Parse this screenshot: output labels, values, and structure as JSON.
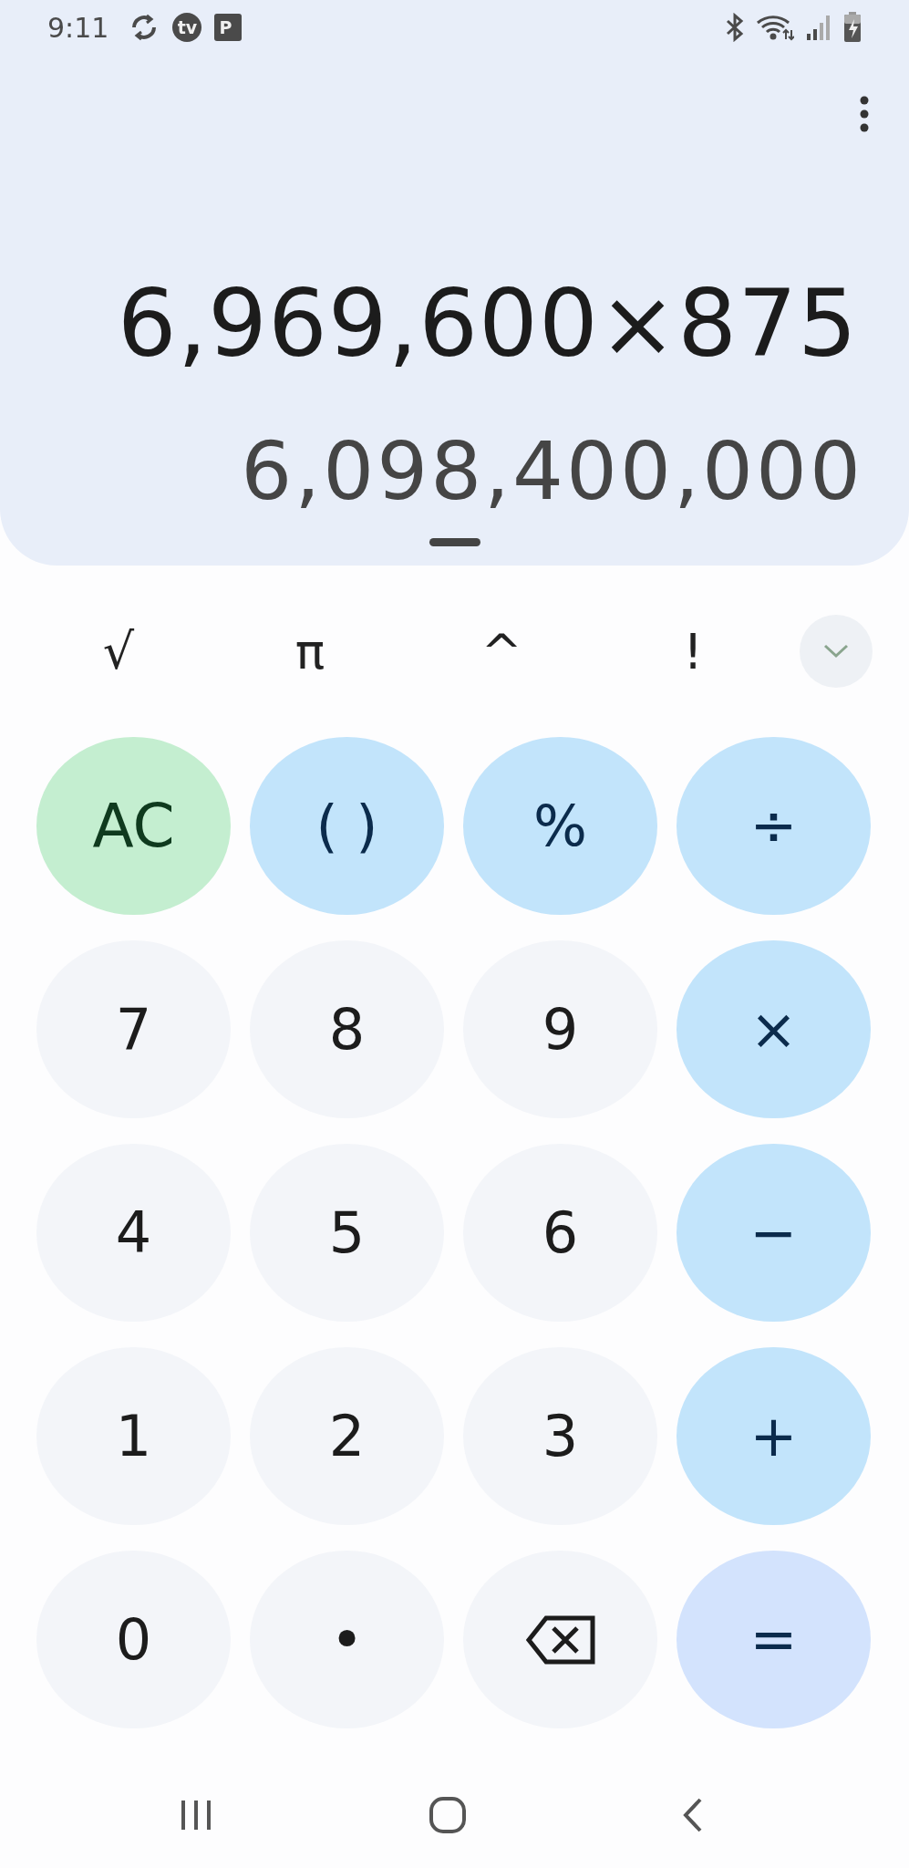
{
  "status_bar": {
    "time": "9:11",
    "app_badges": [
      {
        "kind": "sync"
      },
      {
        "kind": "circle",
        "label": "tv"
      },
      {
        "kind": "square",
        "label": "P"
      }
    ]
  },
  "display": {
    "expression": "6,969,600×875",
    "result": "6,098,400,000"
  },
  "function_row": {
    "keys": [
      "√",
      "π",
      "^",
      "!"
    ],
    "expanded": false
  },
  "keypad": [
    {
      "label": "AC",
      "kind": "clear"
    },
    {
      "label": "( )",
      "kind": "operator"
    },
    {
      "label": "%",
      "kind": "operator"
    },
    {
      "label": "÷",
      "kind": "operator"
    },
    {
      "label": "7",
      "kind": "digit"
    },
    {
      "label": "8",
      "kind": "digit"
    },
    {
      "label": "9",
      "kind": "digit"
    },
    {
      "label": "×",
      "kind": "operator"
    },
    {
      "label": "4",
      "kind": "digit"
    },
    {
      "label": "5",
      "kind": "digit"
    },
    {
      "label": "6",
      "kind": "digit"
    },
    {
      "label": "−",
      "kind": "operator"
    },
    {
      "label": "1",
      "kind": "digit"
    },
    {
      "label": "2",
      "kind": "digit"
    },
    {
      "label": "3",
      "kind": "digit"
    },
    {
      "label": "+",
      "kind": "operator"
    },
    {
      "label": "0",
      "kind": "digit"
    },
    {
      "label": "•",
      "kind": "digit"
    },
    {
      "kind": "backspace"
    },
    {
      "label": "=",
      "kind": "equals"
    }
  ]
}
